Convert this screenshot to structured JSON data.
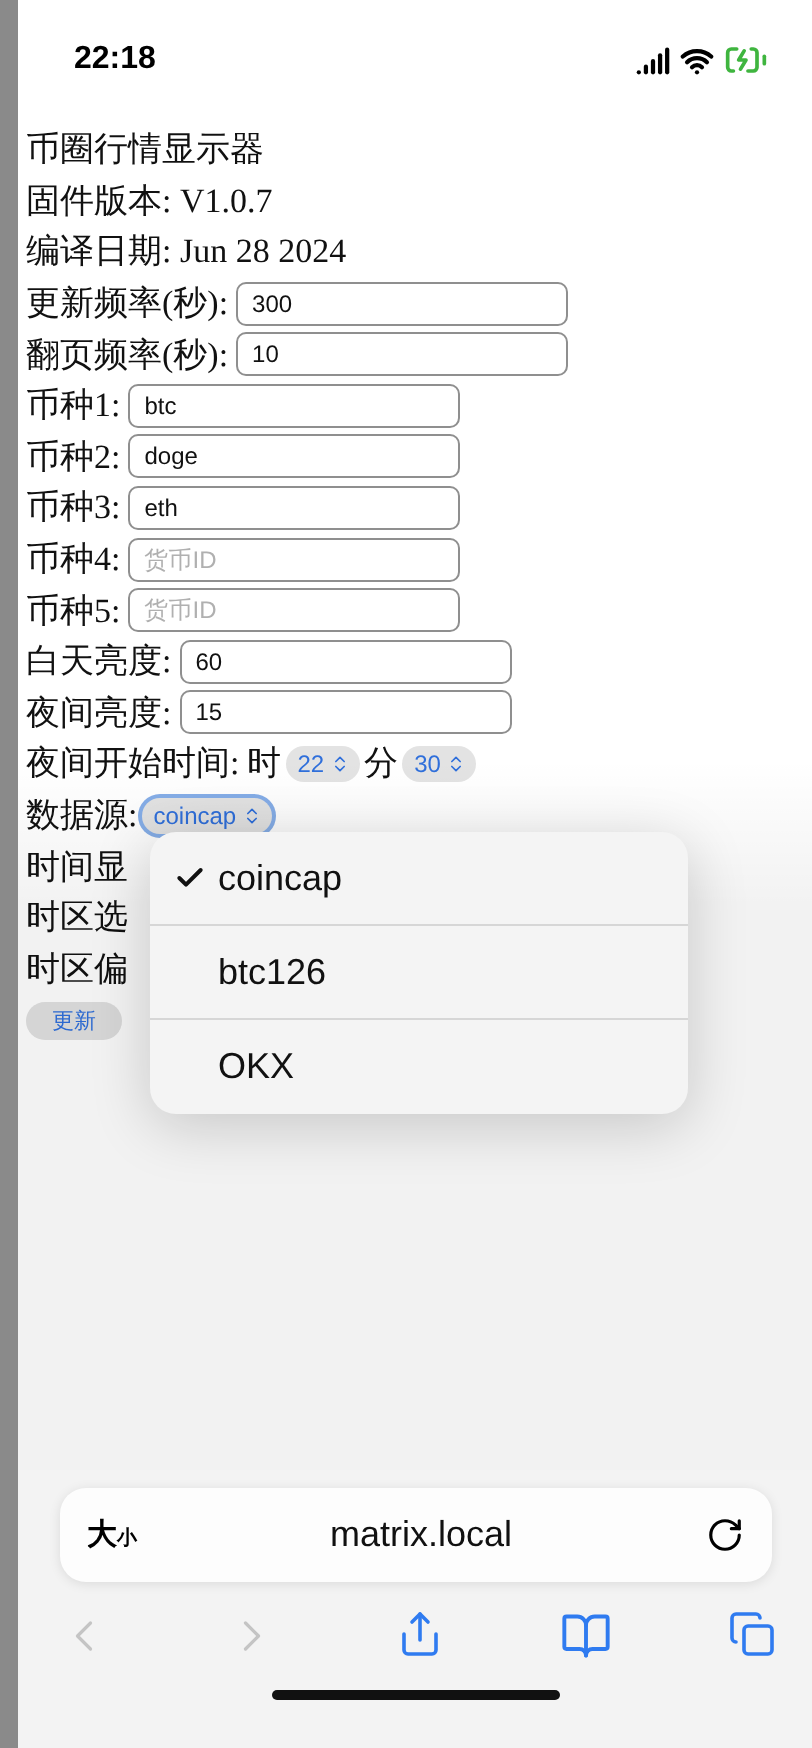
{
  "status_bar": {
    "time": "22:18"
  },
  "page": {
    "title": "币圈行情显示器",
    "info": [
      "固件版本: V1.0.7",
      "编译日期: Jun 28 2024"
    ],
    "fields": [
      {
        "label": "更新频率(秒):",
        "value": "300"
      },
      {
        "label": "翻页频率(秒):",
        "value": "10"
      },
      {
        "label": "币种1:",
        "value": "btc"
      },
      {
        "label": "币种2:",
        "value": "doge"
      },
      {
        "label": "币种3:",
        "value": "eth"
      },
      {
        "label": "币种4:",
        "placeholder": "货币ID"
      },
      {
        "label": "币种5:",
        "placeholder": "货币ID"
      },
      {
        "label": "白天亮度:",
        "value": "60"
      },
      {
        "label": "夜间亮度:",
        "value": "15"
      }
    ],
    "night_start": {
      "label": "夜间开始时间:",
      "hour_label": "时",
      "hour": "22",
      "minute_label": "分",
      "minute": "30"
    },
    "data_source": {
      "label": "数据源:",
      "value": "coincap"
    },
    "covered_labels": [
      "时间显",
      "时区选",
      "时区偏"
    ],
    "update_button": "更新"
  },
  "menu": {
    "options": [
      {
        "label": "coincap",
        "selected": true
      },
      {
        "label": "btc126",
        "selected": false
      },
      {
        "label": "OKX",
        "selected": false
      }
    ]
  },
  "browser": {
    "text_size_large": "大",
    "text_size_small": "小",
    "address": "matrix.local"
  }
}
